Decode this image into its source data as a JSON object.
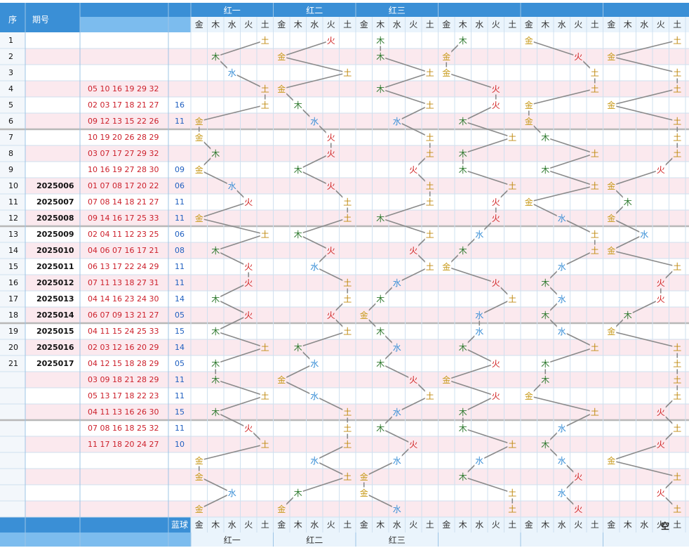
{
  "header": {
    "col_seq": "序",
    "col_period": "期号",
    "groups": [
      "红一",
      "红二",
      "红三",
      "",
      "",
      ""
    ],
    "elements": [
      "金",
      "木",
      "水",
      "火",
      "土"
    ],
    "blue_label": "蓝球",
    "corner_mark": "空"
  },
  "colors": {
    "header_blue": "#3a8fd6",
    "header_light": "#7cbcee",
    "grid": "#cfe0ef",
    "row_pink": "#fbe9ee",
    "row_white": "#ffffff",
    "red_numbers": "#cc1f2a",
    "blue_numbers": "#2060c0",
    "line": "#8a8a8a",
    "jin": "#c89a1a",
    "mu": "#2f7a2f",
    "shui": "#3a8fd6",
    "huo": "#d02020",
    "tu": "#c08a10"
  },
  "rows": [
    {
      "seq": "1",
      "period": "",
      "reds": "",
      "blue": ""
    },
    {
      "seq": "2",
      "period": "",
      "reds": "",
      "blue": ""
    },
    {
      "seq": "3",
      "period": "",
      "reds": "",
      "blue": ""
    },
    {
      "seq": "4",
      "period": "",
      "reds": "05 10 16 19 29 32",
      "blue": ""
    },
    {
      "seq": "5",
      "period": "",
      "reds": "02 03 17 18 21 27",
      "blue": "16"
    },
    {
      "seq": "6",
      "period": "",
      "reds": "09 12 13 15 22 26",
      "blue": "11"
    },
    {
      "seq": "7",
      "period": "",
      "reds": "10 19 20 26 28 29",
      "blue": ""
    },
    {
      "seq": "8",
      "period": "",
      "reds": "03 07 17 27 29 32",
      "blue": ""
    },
    {
      "seq": "9",
      "period": "",
      "reds": "10 16 19 27 28 30",
      "blue": "09"
    },
    {
      "seq": "10",
      "period": "2025006",
      "reds": "01 07 08 17 20 22",
      "blue": "06"
    },
    {
      "seq": "11",
      "period": "2025007",
      "reds": "07 08 14 18 21 27",
      "blue": "11"
    },
    {
      "seq": "12",
      "period": "2025008",
      "reds": "09 14 16 17 25 33",
      "blue": "11"
    },
    {
      "seq": "13",
      "period": "2025009",
      "reds": "02 04 11 12 23 25",
      "blue": "06"
    },
    {
      "seq": "14",
      "period": "2025010",
      "reds": "04 06 07 16 17 21",
      "blue": "08"
    },
    {
      "seq": "15",
      "period": "2025011",
      "reds": "06 13 17 22 24 29",
      "blue": "11"
    },
    {
      "seq": "16",
      "period": "2025012",
      "reds": "07 11 13 18 27 31",
      "blue": "11"
    },
    {
      "seq": "17",
      "period": "2025013",
      "reds": "04 14 16 23 24 30",
      "blue": "14"
    },
    {
      "seq": "18",
      "period": "2025014",
      "reds": "06 07 09 13 21 27",
      "blue": "05"
    },
    {
      "seq": "19",
      "period": "2025015",
      "reds": "04 11 15 24 25 33",
      "blue": "15"
    },
    {
      "seq": "20",
      "period": "2025016",
      "reds": "02 03 12 16 20 29",
      "blue": "14"
    },
    {
      "seq": "21",
      "period": "2025017",
      "reds": "04 12 15 18 28 29",
      "blue": "05"
    },
    {
      "seq": "",
      "period": "",
      "reds": "03 09 18 21 28 29",
      "blue": "11"
    },
    {
      "seq": "",
      "period": "",
      "reds": "05 13 17 18 22 23",
      "blue": "11"
    },
    {
      "seq": "",
      "period": "",
      "reds": "04 11 13 16 26 30",
      "blue": "15"
    },
    {
      "seq": "",
      "period": "",
      "reds": "07 08 16 18 25 32",
      "blue": "11"
    },
    {
      "seq": "",
      "period": "",
      "reds": "11 17 18 20 24 27",
      "blue": "10"
    },
    {
      "seq": "",
      "period": "",
      "reds": "",
      "blue": ""
    },
    {
      "seq": "",
      "period": "",
      "reds": "",
      "blue": ""
    },
    {
      "seq": "",
      "period": "",
      "reds": "",
      "blue": ""
    },
    {
      "seq": "",
      "period": "",
      "reds": "",
      "blue": ""
    }
  ],
  "chart_data": {
    "type": "table",
    "element_order": [
      "金",
      "木",
      "水",
      "火",
      "土"
    ],
    "series": [
      {
        "name": "红一",
        "values": [
          "土",
          "木",
          "水",
          "土",
          "土",
          "金",
          "金",
          "木",
          "金",
          "水",
          "火",
          "金",
          "土",
          "木",
          "火",
          "火",
          "木",
          "火",
          "木",
          "土",
          "木",
          "木",
          "土",
          "木",
          "火",
          "土",
          "金",
          "金",
          "水",
          "金"
        ]
      },
      {
        "name": "红二",
        "values": [
          "火",
          "金",
          "土",
          "金",
          "木",
          "水",
          "火",
          "火",
          "木",
          "火",
          "土",
          "土",
          "木",
          "火",
          "水",
          "土",
          "土",
          "火",
          "土",
          "木",
          "水",
          "金",
          "水",
          "土",
          "土",
          "土",
          "水",
          "土",
          "木",
          "金"
        ]
      },
      {
        "name": "红三",
        "values": [
          "木",
          "木",
          "土",
          "木",
          "土",
          "水",
          "土",
          "土",
          "火",
          "土",
          "土",
          "木",
          "土",
          "火",
          "土",
          "水",
          "木",
          "金",
          "木",
          "水",
          "木",
          "火",
          "土",
          "水",
          "木",
          "火",
          "水",
          "金",
          "金",
          "水"
        ]
      },
      {
        "name": "",
        "values": [
          "木",
          "金",
          "金",
          "火",
          "火",
          "木",
          "土",
          "木",
          "木",
          "土",
          "火",
          "火",
          "水",
          "木",
          "金",
          "火",
          "土",
          "水",
          "水",
          "木",
          "火",
          "金",
          "火",
          "木",
          "木",
          "土",
          "水",
          "木",
          "土",
          "土"
        ]
      },
      {
        "name": "",
        "values": [
          "金",
          "火",
          "土",
          "土",
          "金",
          "金",
          "木",
          "土",
          "木",
          "土",
          "金",
          "水",
          "土",
          "土",
          "水",
          "木",
          "水",
          "木",
          "水",
          "土",
          "木",
          "木",
          "金",
          "土",
          "水",
          "木",
          "水",
          "火",
          "水",
          "火"
        ]
      },
      {
        "name": "",
        "values": [
          "土",
          "金",
          "土",
          "土",
          "金",
          "土",
          "土",
          "土",
          "火",
          "金",
          "木",
          "金",
          "水",
          "金",
          "土",
          "火",
          "火",
          "木",
          "金",
          "土",
          "土",
          "土",
          "土",
          "火",
          "土",
          "火",
          "金",
          "土",
          "火",
          "土"
        ]
      }
    ]
  }
}
